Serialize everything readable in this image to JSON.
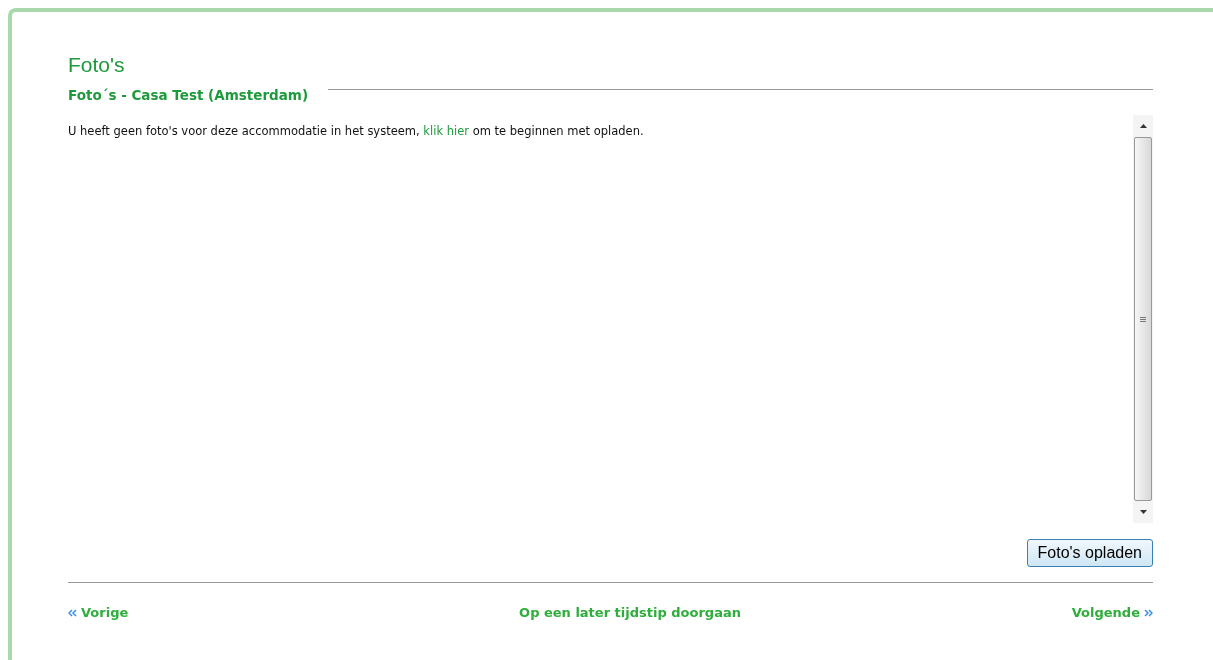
{
  "page": {
    "title": "Foto's",
    "subtitle": "Foto´s - Casa Test (Amsterdam)"
  },
  "message": {
    "before": "U heeft geen foto's voor deze accommodatie in het systeem, ",
    "link": "klik hier",
    "after": " om te beginnen met opladen."
  },
  "upload_button": "Foto's opladen",
  "navigation": [
    {
      "kind": "previous",
      "label": "Vorige"
    },
    {
      "kind": "later",
      "label": "Op een later tijdstip doorgaan"
    },
    {
      "kind": "next",
      "label": "Volgende"
    }
  ]
}
